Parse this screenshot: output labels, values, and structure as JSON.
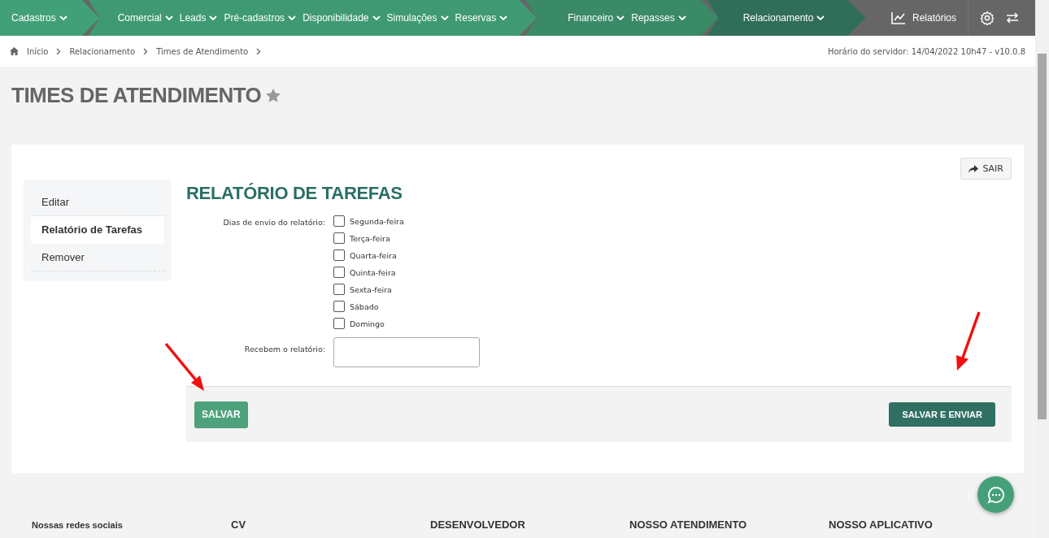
{
  "nav": {
    "groups": [
      {
        "color": "#41a078",
        "items": [
          "Cadastros"
        ]
      },
      {
        "color": "#3f9a73",
        "items": [
          "Comercial",
          "Leads",
          "Pré-cadastros",
          "Disponibilidade",
          "Simulações",
          "Reservas"
        ]
      },
      {
        "color": "#3a8a68",
        "items": [
          "Financeiro",
          "Repasses"
        ]
      },
      {
        "color": "#2f6e58",
        "items": [
          "Relacionamento"
        ]
      }
    ],
    "reports": "Relatórios"
  },
  "breadcrumb": [
    "Início",
    "Relacionamento",
    "Times de Atendimento"
  ],
  "server_time": "Horário do servidor: 14/04/2022 10h47 - v10.0.8",
  "page_title": "TIMES DE ATENDIMENTO",
  "exit_button": "SAIR",
  "side_menu": [
    {
      "label": "Editar",
      "selected": false
    },
    {
      "label": "Relatório de Tarefas",
      "selected": true
    },
    {
      "label": "Remover",
      "selected": false
    }
  ],
  "section_title": "RELATÓRIO DE TAREFAS",
  "days_label": "Dias de envio do relatório:",
  "days": [
    {
      "label": "Segunda-feira",
      "checked": false
    },
    {
      "label": "Terça-feira",
      "checked": false
    },
    {
      "label": "Quarta-feira",
      "checked": false
    },
    {
      "label": "Quinta-feira",
      "checked": false
    },
    {
      "label": "Sexta-feira",
      "checked": false
    },
    {
      "label": "Sábado",
      "checked": false
    },
    {
      "label": "Domingo",
      "checked": false
    }
  ],
  "recipients_label": "Recebem o relatório:",
  "save_button": "SALVAR",
  "save_send_button": "SALVAR E ENVIAR",
  "footer": {
    "social": "Nossas redes sociais",
    "columns": [
      "CV",
      "DESENVOLVEDOR",
      "NOSSO ATENDIMENTO",
      "NOSSO APLICATIVO"
    ]
  }
}
